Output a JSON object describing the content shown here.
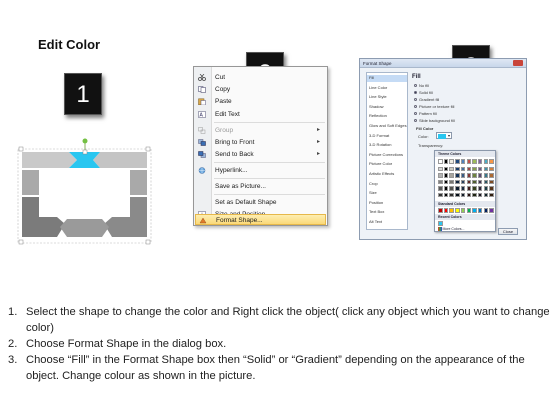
{
  "title": "Edit Color",
  "steps_badges": [
    "1",
    "2",
    "3"
  ],
  "context_menu": {
    "items": [
      {
        "label": "Cut",
        "icon": "scissors-icon",
        "disabled": false,
        "submenu": false
      },
      {
        "label": "Copy",
        "icon": "copy-icon",
        "disabled": false,
        "submenu": false
      },
      {
        "label": "Paste",
        "icon": "paste-icon",
        "disabled": false,
        "submenu": false
      },
      {
        "label": "Edit Text",
        "icon": "edit-text-icon",
        "disabled": false,
        "submenu": false
      },
      {
        "label": "Group",
        "icon": "group-icon",
        "disabled": true,
        "submenu": true
      },
      {
        "label": "Bring to Front",
        "icon": "bring-front-icon",
        "disabled": false,
        "submenu": true
      },
      {
        "label": "Send to Back",
        "icon": "send-back-icon",
        "disabled": false,
        "submenu": true
      },
      {
        "label": "Hyperlink...",
        "icon": "hyperlink-icon",
        "disabled": false,
        "submenu": false
      },
      {
        "label": "Save as Picture...",
        "icon": "",
        "disabled": false,
        "submenu": false
      },
      {
        "label": "Set as Default Shape",
        "icon": "",
        "disabled": false,
        "submenu": false
      },
      {
        "label": "Size and Position...",
        "icon": "size-position-icon",
        "disabled": false,
        "submenu": false
      },
      {
        "label": "Format Shape...",
        "icon": "format-shape-icon",
        "disabled": false,
        "submenu": false,
        "highlighted": true
      }
    ]
  },
  "dialog": {
    "title": "Format Shape",
    "categories": [
      "Fill",
      "Line Color",
      "Line Style",
      "Shadow",
      "Reflection",
      "Glow and Soft Edges",
      "3-D Format",
      "3-D Rotation",
      "Picture Corrections",
      "Picture Color",
      "Artistic Effects",
      "Crop",
      "Size",
      "Position",
      "Text Box",
      "Alt Text"
    ],
    "selected_category": "Fill",
    "pane_title": "Fill",
    "fill_options": [
      "No fill",
      "Solid fill",
      "Gradient fill",
      "Picture or texture fill",
      "Pattern fill",
      "Slide background fill"
    ],
    "selected_fill": "Solid fill",
    "fill_color_label": "Fill Color",
    "color_label": "Color:",
    "transparency_label": "Transparency:",
    "theme_colors_label": "Theme Colors",
    "standard_colors_label": "Standard Colors",
    "recent_colors_label": "Recent Colors",
    "more_colors_label": "More Colors...",
    "close_label": "Close"
  },
  "instructions": [
    {
      "num": "1.",
      "text": "Select the shape to change the color and Right click the object( click any object which you want to change color)"
    },
    {
      "num": "2.",
      "text": "Choose Format Shape in the dialog box."
    },
    {
      "num": "3.",
      "text": "Choose “Fill” in the Format Shape box then “Solid” or “Gradient” depending on the appearance of the object. Change colour as shown in the picture."
    }
  ],
  "colors": {
    "accent_cyan": "#29c6f0",
    "shape_gray_light": "#c9c9c9",
    "shape_gray_mid": "#a6a6a6",
    "shape_gray_dark": "#7b7b7b",
    "menu_highlight": "#fbd978"
  }
}
